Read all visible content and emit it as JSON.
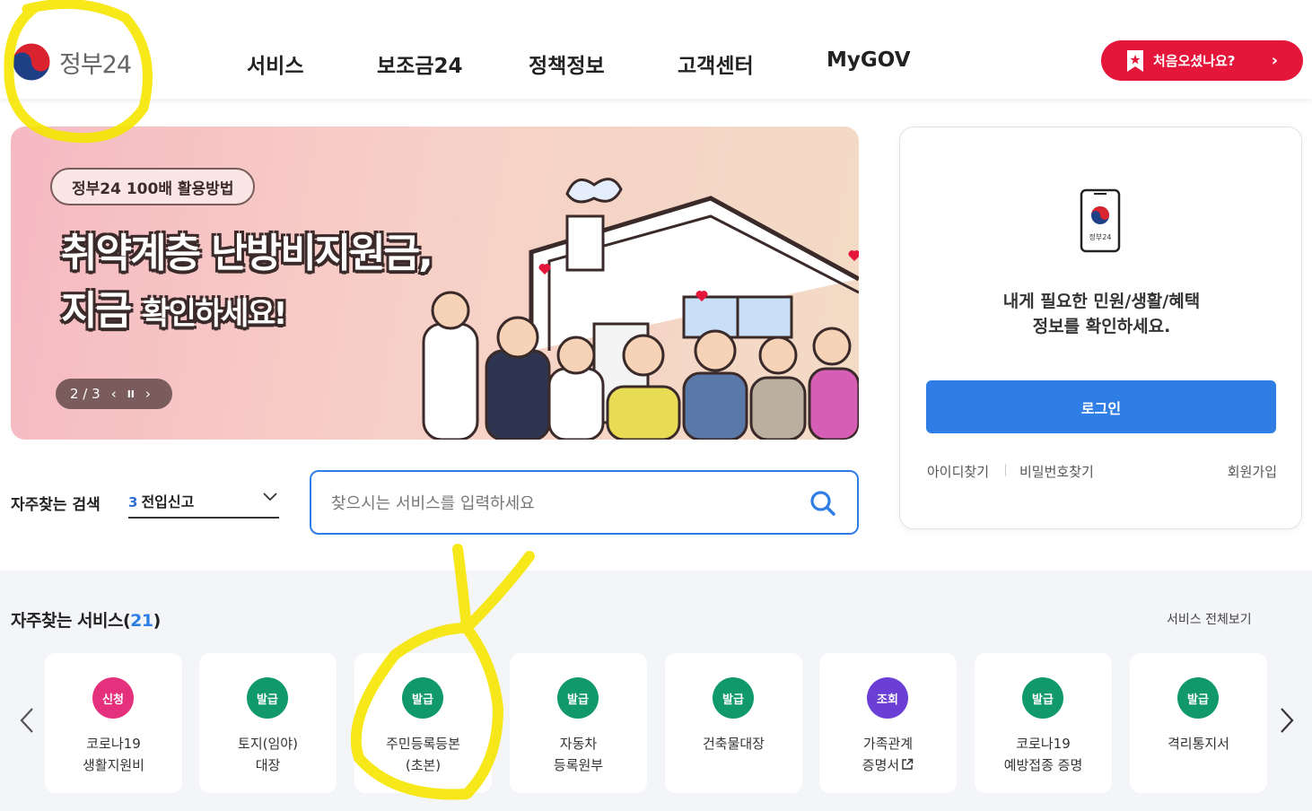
{
  "header": {
    "logo_text": "정부24",
    "nav": [
      "서비스",
      "보조금24",
      "정책정보",
      "고객센터",
      "MyGOV"
    ],
    "first_visit_label": "처음오셨나요?"
  },
  "banner": {
    "pill": "정부24 100배 활용방법",
    "title_line1": "취약계층 난방비지원금,",
    "title_line2_a": "지금",
    "title_line2_b": "확인하세요!",
    "pager": "2 / 3"
  },
  "login": {
    "phone_label": "정부24",
    "message_line1": "내게 필요한 민원/생활/혜택",
    "message_line2": "정보를 확인하세요.",
    "login_button": "로그인",
    "find_id": "아이디찾기",
    "find_pw": "비밀번호찾기",
    "signup": "회원가입"
  },
  "search": {
    "freq_label": "자주찾는 검색",
    "freq_rank": "3",
    "freq_value": "전입신고",
    "placeholder": "찾으시는 서비스를 입력하세요"
  },
  "services": {
    "title": "자주찾는 서비스(",
    "count": "21",
    "title_close": ")",
    "view_all": "서비스 전체보기",
    "cards": [
      {
        "badge": "신청",
        "color": "#e5317d",
        "label": "코로나19\n생활지원비"
      },
      {
        "badge": "발급",
        "color": "#11996b",
        "label": "토지(임야)\n대장"
      },
      {
        "badge": "발급",
        "color": "#11996b",
        "label": "주민등록등본\n(초본)"
      },
      {
        "badge": "발급",
        "color": "#11996b",
        "label": "자동차\n등록원부"
      },
      {
        "badge": "발급",
        "color": "#11996b",
        "label": "건축물대장"
      },
      {
        "badge": "조회",
        "color": "#6b3fd6",
        "label": "가족관계\n증명서"
      },
      {
        "badge": "발급",
        "color": "#11996b",
        "label": "코로나19\n예방접종 증명"
      },
      {
        "badge": "발급",
        "color": "#11996b",
        "label": "격리통지서"
      }
    ]
  },
  "colors": {
    "accent_blue": "#2f7ee6",
    "brand_red": "#e4173b",
    "highlight_yellow": "#f5e600"
  }
}
